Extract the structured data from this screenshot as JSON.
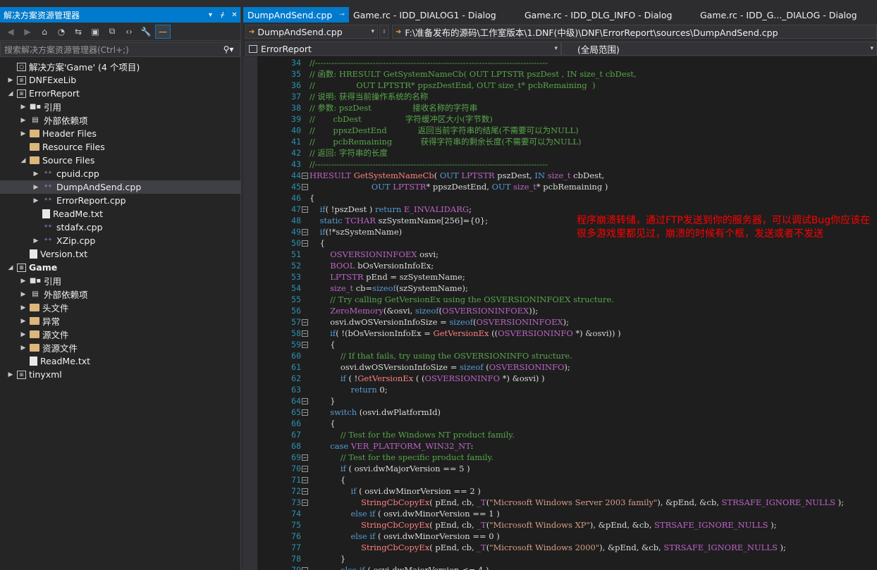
{
  "solution_explorer": {
    "title": "解决方案资源管理器",
    "title_buttons": [
      "▾",
      "📌",
      "✕"
    ],
    "search_placeholder": "搜索解决方案资源管理器(Ctrl+;)",
    "tree": [
      {
        "label": "解决方案'Game' (4 个项目)",
        "level": 0,
        "icon": "solution-icon",
        "arrow": ""
      },
      {
        "label": "DNFExeLib",
        "level": 0,
        "icon": "project-icon",
        "arrow": "▶"
      },
      {
        "label": "ErrorReport",
        "level": 0,
        "icon": "project-icon",
        "arrow": "◢"
      },
      {
        "label": "引用",
        "level": 1,
        "icon": "references-icon",
        "arrow": "▶"
      },
      {
        "label": "外部依赖项",
        "level": 1,
        "icon": "external-deps-icon",
        "arrow": "▶"
      },
      {
        "label": "Header Files",
        "level": 1,
        "icon": "folder-icon",
        "arrow": "▶"
      },
      {
        "label": "Resource Files",
        "level": 1,
        "icon": "folder-icon",
        "arrow": ""
      },
      {
        "label": "Source Files",
        "level": 1,
        "icon": "folder-icon",
        "arrow": "◢"
      },
      {
        "label": "cpuid.cpp",
        "level": 2,
        "icon": "cpp-file-icon",
        "arrow": "▶"
      },
      {
        "label": "DumpAndSend.cpp",
        "level": 2,
        "icon": "cpp-file-icon",
        "arrow": "▶",
        "selected": true
      },
      {
        "label": "ErrorReport.cpp",
        "level": 2,
        "icon": "cpp-file-icon",
        "arrow": "▶"
      },
      {
        "label": "ReadMe.txt",
        "level": 2,
        "icon": "text-file-icon",
        "arrow": ""
      },
      {
        "label": "stdafx.cpp",
        "level": 2,
        "icon": "cpp-file-icon",
        "arrow": ""
      },
      {
        "label": "XZip.cpp",
        "level": 2,
        "icon": "cpp-file-icon",
        "arrow": "▶"
      },
      {
        "label": "Version.txt",
        "level": 1,
        "icon": "text-file-icon",
        "arrow": ""
      },
      {
        "label": "Game",
        "level": 0,
        "icon": "project-icon",
        "arrow": "◢",
        "bold": true
      },
      {
        "label": "引用",
        "level": 1,
        "icon": "references-icon",
        "arrow": "▶"
      },
      {
        "label": "外部依赖项",
        "level": 1,
        "icon": "external-deps-icon",
        "arrow": "▶"
      },
      {
        "label": "头文件",
        "level": 1,
        "icon": "folder-icon",
        "arrow": "▶"
      },
      {
        "label": "异常",
        "level": 1,
        "icon": "folder-icon",
        "arrow": "▶"
      },
      {
        "label": "源文件",
        "level": 1,
        "icon": "folder-icon",
        "arrow": "▶"
      },
      {
        "label": "资源文件",
        "level": 1,
        "icon": "folder-icon",
        "arrow": "▶"
      },
      {
        "label": "ReadMe.txt",
        "level": 1,
        "icon": "text-file-icon",
        "arrow": ""
      },
      {
        "label": "tinyxml",
        "level": 0,
        "icon": "project-icon",
        "arrow": "▶"
      }
    ]
  },
  "tabs": [
    {
      "label": "DumpAndSend.cpp",
      "active": true
    },
    {
      "label": "Game.rc - IDD_DIALOG1 - Dialog"
    },
    {
      "label": "Game.rc - IDD_DLG_INFO - Dialog"
    },
    {
      "label": "Game.rc - IDD_G..._DIALOG - Dialog"
    }
  ],
  "nav": {
    "file_dropdown": "DumpAndSend.cpp",
    "path": "F:\\准备发布的源码\\工作室版本\\1.DNF(中级)\\DNF\\ErrorReport\\sources\\DumpAndSend.cpp",
    "project_dropdown": "ErrorReport",
    "scope_dropdown": "(全局范围)"
  },
  "editor": {
    "first_line": 34,
    "line_numbers": [
      "34",
      "35",
      "36",
      "37",
      "38",
      "39",
      "40",
      "41",
      "42",
      "43",
      "44",
      "45",
      "46",
      "47",
      "48",
      "49",
      "50",
      "51",
      "52",
      "53",
      "54",
      "55",
      "56",
      "57",
      "58",
      "59",
      "60",
      "61",
      "62",
      "63",
      "64",
      "65",
      "66",
      "67",
      "68",
      "69",
      "70",
      "71",
      "72",
      "73",
      "74",
      "75",
      "76",
      "77",
      "78",
      "79"
    ],
    "lines_html": [
      "<span class='c'>//-------------------------------------------------------------------------------------</span>",
      "<span class='c'>// 函数: HRESULT GetSystemNameCb( OUT LPTSTR pszDest , IN size_t cbDest,</span>",
      "<span class='c'>//                OUT LPTSTR* ppszDestEnd, OUT size_t* pcbRemaining  )</span>",
      "<span class='c'>// 说明: 获得当前操作系统的名称</span>",
      "<span class='c'>// 参数: pszDest                接收名称的字符串</span>",
      "<span class='c'>//       cbDest                 字符缓冲区大小(字节数)</span>",
      "<span class='c'>//       ppszDestEnd            返回当前字符串的结尾(不需要可以为NULL)</span>",
      "<span class='c'>//       pcbRemaining           获得字符串的剩余长度(不需要可以为NULL)</span>",
      "<span class='c'>// 返回: 字符串的长度</span>",
      "<span class='c'>//-------------------------------------------------------------------------------------</span>",
      "<span class='mac'>HRESULT</span> <span class='fn'>GetSystemNameCb</span>( <span class='k'>OUT</span> <span class='mac'>LPTSTR</span> pszDest, <span class='k'>IN</span> <span class='mac'>size_t</span> cbDest,",
      "                        <span class='k'>OUT</span> <span class='mac'>LPTSTR</span>* ppszDestEnd, <span class='k'>OUT</span> <span class='mac'>size_t</span>* pcbRemaining )",
      "{",
      "    <span class='k'>if</span>( !pszDest ) <span class='k'>return</span> <span class='mac'>E_INVALIDARG</span>;",
      "    <span class='k'>static</span> <span class='mac'>TCHAR</span> szSystemName[256]={0};",
      "    <span class='k'>if</span>(!*szSystemName)",
      "    {",
      "        <span class='mac'>OSVERSIONINFOEX</span> osvi;",
      "        <span class='mac'>BOOL</span> bOsVersionInfoEx;",
      "        <span class='mac'>LPTSTR</span> pEnd = szSystemName;",
      "        <span class='mac'>size_t</span> cb=<span class='k'>sizeof</span>(szSystemName);",
      "        <span class='c'>// Try calling GetVersionEx using the OSVERSIONINFOEX structure.</span>",
      "        <span class='mac'>ZeroMemory</span>(&amp;osvi, <span class='k'>sizeof</span>(<span class='mac'>OSVERSIONINFOEX</span>));",
      "        osvi.dwOSVersionInfoSize = <span class='k'>sizeof</span>(<span class='mac'>OSVERSIONINFOEX</span>);",
      "        <span class='k'>if</span>( !(bOsVersionInfoEx = <span class='fn'>GetVersionEx</span> ((<span class='mac'>OSVERSIONINFO</span> *) &amp;osvi)) )",
      "        {",
      "            <span class='c'>// If that fails, try using the OSVERSIONINFO structure.</span>",
      "            osvi.dwOSVersionInfoSize = <span class='k'>sizeof</span> (<span class='mac'>OSVERSIONINFO</span>);",
      "            <span class='k'>if</span> ( !<span class='fn'>GetVersionEx</span> ( (<span class='mac'>OSVERSIONINFO</span> *) &amp;osvi) )",
      "                <span class='k'>return</span> 0;",
      "        }",
      "        <span class='k'>switch</span> (osvi.dwPlatformId)",
      "        {",
      "            <span class='c'>// Test for the Windows NT product family.</span>",
      "        <span class='k'>case</span> <span class='mac'>VER_PLATFORM_WIN32_NT</span>:",
      "            <span class='c'>// Test for the specific product family.</span>",
      "            <span class='k'>if</span> ( osvi.dwMajorVersion == 5 )",
      "            {",
      "                <span class='k'>if</span> ( osvi.dwMinorVersion == 2 )",
      "                    <span class='fn'>StringCbCopyEx</span>( pEnd, cb, <span class='mac'>_T</span>(<span class='s'>\"Microsoft Windows Server 2003 family\"</span>), &amp;pEnd, &amp;cb, <span class='mac'>STRSAFE_IGNORE_NULLS</span> );",
      "                <span class='k'>else</span> <span class='k'>if</span> ( osvi.dwMinorVersion == 1 )",
      "                    <span class='fn'>StringCbCopyEx</span>( pEnd, cb, <span class='mac'>_T</span>(<span class='s'>\"Microsoft Windows XP\"</span>), &amp;pEnd, &amp;cb, <span class='mac'>STRSAFE_IGNORE_NULLS</span> );",
      "                <span class='k'>else</span> <span class='k'>if</span> ( osvi.dwMinorVersion == 0 )",
      "                    <span class='fn'>StringCbCopyEx</span>( pEnd, cb, <span class='mac'>_T</span>(<span class='s'>\"Microsoft Windows 2000\"</span>), &amp;pEnd, &amp;cb, <span class='mac'>STRSAFE_IGNORE_NULLS</span> );",
      "            }",
      "            <span class='k'>else</span> <span class='k'>if</span> ( osvi.dwMajorVersion &lt;= 4 )"
    ],
    "fold_lines": [
      44,
      45,
      47,
      49,
      50,
      57,
      58,
      59,
      64,
      65,
      69,
      70,
      71,
      72,
      73,
      79
    ]
  },
  "annotation": "程序崩溃转储，通过FTP发送到你的服务器，可以调试Bug你应该在很多游戏里都见过，崩溃的时候有个框，发送或者不发送"
}
